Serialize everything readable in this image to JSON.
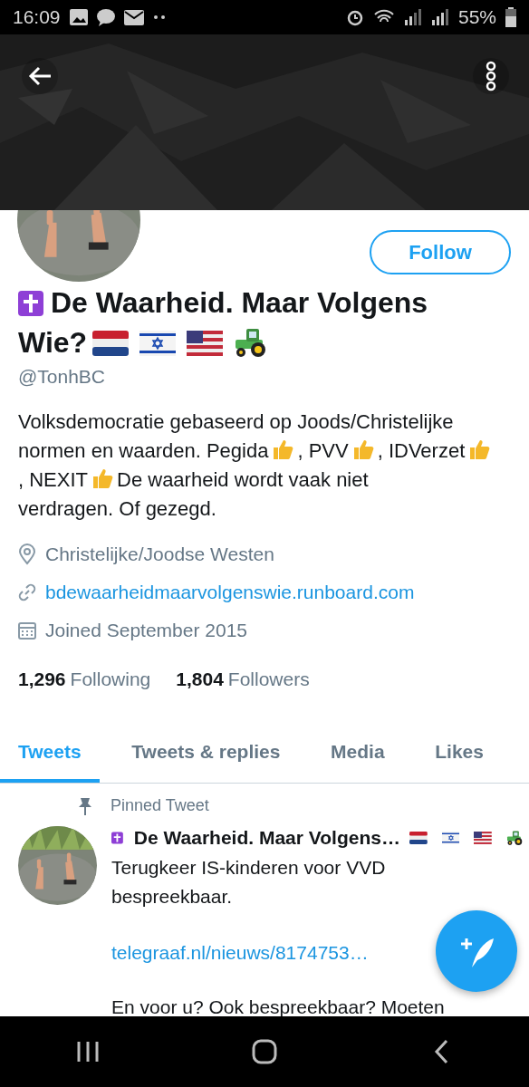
{
  "status_bar": {
    "time": "16:09",
    "battery": "55%"
  },
  "profile": {
    "name": [
      "De Waarheid. Maar Volgens",
      "Wie?"
    ],
    "handle": "@TonhBC",
    "follow_button": "Follow",
    "bio": [
      {
        "kind": "text",
        "text": "Volksdemocratie gebaseerd op Joods/Christelijke"
      },
      {
        "kind": "text",
        "text": "normen en waarden. Pegida"
      },
      {
        "kind": "icon"
      },
      {
        "kind": "text",
        "text": ", PVV"
      },
      {
        "kind": "icon"
      },
      {
        "kind": "text",
        "text": ", IDVerzet"
      },
      {
        "kind": "icon"
      },
      {
        "kind": "text",
        "text": ", NEXIT"
      },
      {
        "kind": "icon"
      },
      {
        "kind": "text",
        "text": "De waarheid wordt vaak niet"
      },
      {
        "kind": "text",
        "text": "verdragen. Of gezegd."
      }
    ],
    "location": "Christelijke/Joodse Westen",
    "website": "bdewaarheidmaarvolgenswie.runboard.com",
    "joined": "Joined September 2015",
    "stats": [
      {
        "count": "1,296",
        "label": "Following"
      },
      {
        "count": "1,804",
        "label": "Followers"
      }
    ]
  },
  "tabs": [
    {
      "label": "Tweets",
      "selected": true
    },
    {
      "label": "Tweets & replies",
      "selected": false
    },
    {
      "label": "Media",
      "selected": false
    },
    {
      "label": "Likes",
      "selected": false
    }
  ],
  "pinned_tweet": {
    "label": "Pinned Tweet",
    "author": "De Waarheid. Maar Volgens…",
    "text": "Terugkeer IS-kinderen voor VVD bespreekbaar.",
    "link": "telegraaf.nl/nieuws/8174753…",
    "text_2": "En voor u? Ook bespreekbaar? Moeten"
  }
}
